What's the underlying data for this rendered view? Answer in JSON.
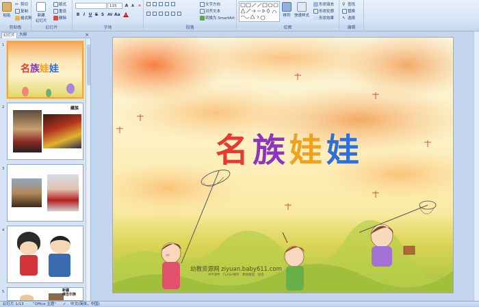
{
  "ribbon": {
    "clipboard": {
      "paste": "粘贴",
      "cut": "剪切",
      "copy": "复制",
      "format_painter": "格式刷",
      "label": "剪贴板"
    },
    "slides": {
      "new_slide": "新建\n幻灯片",
      "layout": "版式",
      "reset": "重设",
      "delete": "删除",
      "label": "幻灯片"
    },
    "font": {
      "name": "",
      "size": "115",
      "label": "字体"
    },
    "paragraph": {
      "text_direction": "文字方向",
      "align_text": "对齐文本",
      "smartart": "转换为 SmartArt",
      "label": "段落"
    },
    "drawing": {
      "arrange": "排列",
      "quick_styles": "快速样式",
      "shape_fill": "形状填充",
      "shape_outline": "形状轮廓",
      "shape_effects": "形状效果",
      "label": "绘图"
    },
    "editing": {
      "find": "查找",
      "replace": "替换",
      "select": "选择",
      "label": "编辑"
    }
  },
  "left_pane": {
    "tab_slides": "幻灯片",
    "tab_outline": "大纲",
    "thumbnails": [
      {
        "number": "1",
        "title": "名族娃娃"
      },
      {
        "number": "2",
        "caption": "藏族"
      },
      {
        "number": "3"
      },
      {
        "number": "4"
      },
      {
        "number": "5",
        "caption": "新疆\n维吾尔族"
      }
    ]
  },
  "slide": {
    "title_chars": [
      "名",
      "族",
      "娃",
      "娃"
    ],
    "title_colors": [
      "#e33b2f",
      "#8b35c2",
      "#f0a21e",
      "#2f6fd8"
    ],
    "watermark": "幼教资源网 ziyuan.baby611.com",
    "watermark_sub": "PPT课件　FLASH课件　教师教案　试卷"
  },
  "status": {
    "slide_info": "幻灯片 1/13",
    "theme": "\"Office 主题\"",
    "language": "中文(简体，中国)"
  }
}
